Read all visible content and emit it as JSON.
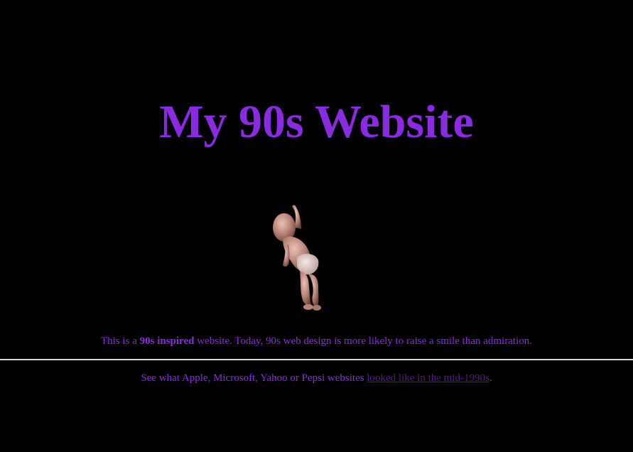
{
  "page": {
    "title": "My 90s Website"
  },
  "intro": {
    "prefix": "This is a ",
    "emphasis": "90s inspired",
    "suffix": " website. Today, 90s web design is more likely to raise a smile than admiration."
  },
  "footer": {
    "prefix": "See what Apple, Microsoft, Yahoo or Pepsi websites ",
    "link_text": "looked like in the mid-1990s",
    "suffix": "."
  },
  "image": {
    "icon": "dancing-baby-icon"
  },
  "colors": {
    "background": "#000000",
    "text": "#8a2be2",
    "visited_link": "#551a8b",
    "divider": "#d8d8d8"
  }
}
